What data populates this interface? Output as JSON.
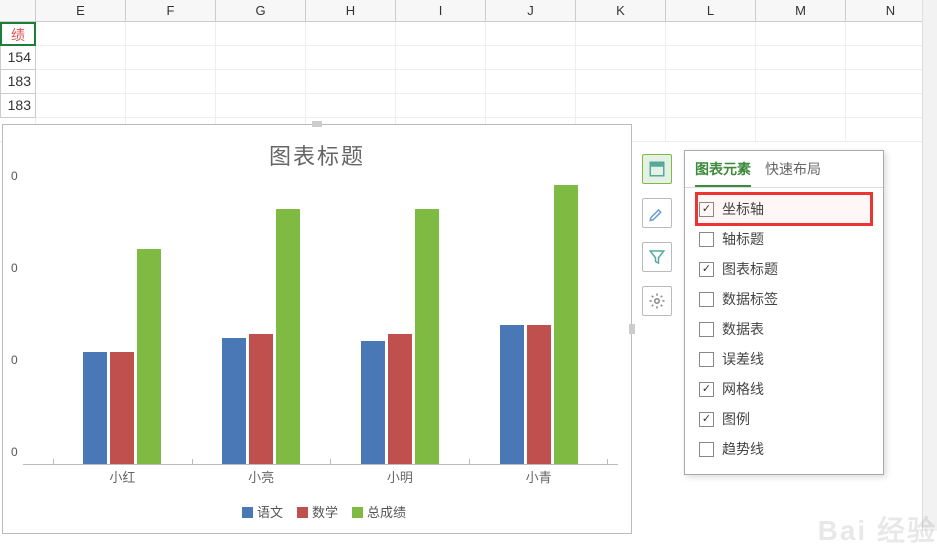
{
  "columns": [
    "",
    "E",
    "F",
    "G",
    "H",
    "I",
    "J",
    "K",
    "L",
    "M",
    "N"
  ],
  "sel_cell": "绩",
  "data_col": [
    "154",
    "183",
    "183"
  ],
  "chart_data": {
    "type": "bar",
    "title": "图表标题",
    "categories": [
      "小红",
      "小亮",
      "小明",
      "小青"
    ],
    "series": [
      {
        "name": "语文",
        "values": [
          80,
          90,
          88,
          100
        ],
        "color": "#4a78b7"
      },
      {
        "name": "数学",
        "values": [
          80,
          93,
          93,
          100
        ],
        "color": "#c0504d"
      },
      {
        "name": "总成绩",
        "values": [
          154,
          183,
          183,
          200
        ],
        "color": "#7fba43"
      }
    ],
    "ylim": [
      0,
      200
    ],
    "y_ticks_visible_suffix": [
      "0",
      "0",
      "0",
      "0"
    ],
    "ylabel": "",
    "xlabel": ""
  },
  "side_buttons": [
    {
      "name": "elements",
      "icon": "grid"
    },
    {
      "name": "styles",
      "icon": "brush"
    },
    {
      "name": "filter",
      "icon": "funnel"
    },
    {
      "name": "settings",
      "icon": "gear"
    }
  ],
  "popup": {
    "tabs": [
      {
        "label": "图表元素",
        "active": true
      },
      {
        "label": "快速布局",
        "active": false
      }
    ],
    "items": [
      {
        "label": "坐标轴",
        "checked": true,
        "highlight": true
      },
      {
        "label": "轴标题",
        "checked": false
      },
      {
        "label": "图表标题",
        "checked": true
      },
      {
        "label": "数据标签",
        "checked": false
      },
      {
        "label": "数据表",
        "checked": false
      },
      {
        "label": "误差线",
        "checked": false
      },
      {
        "label": "网格线",
        "checked": true
      },
      {
        "label": "图例",
        "checked": true
      },
      {
        "label": "趋势线",
        "checked": false
      }
    ]
  },
  "watermark": "Bai 经验"
}
